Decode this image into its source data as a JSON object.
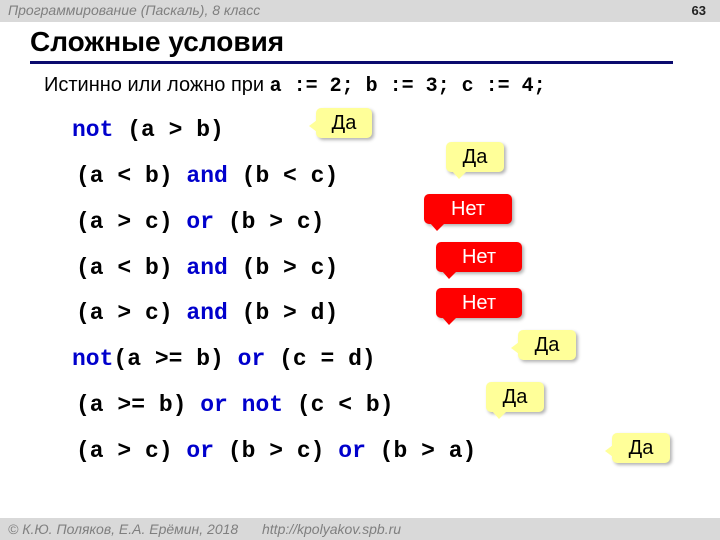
{
  "header": {
    "course": "Программирование (Паскаль), 8 класс",
    "page_number": "63"
  },
  "title": "Сложные условия",
  "intro": {
    "text": "Истинно или ложно при ",
    "assignments": "a := 2; b := 3; c := 4;"
  },
  "expressions": [
    {
      "parts": [
        {
          "t": "not",
          "kw": true
        },
        {
          "t": " (a > b)",
          "kw": false
        }
      ],
      "answer": "Да",
      "truth": true
    },
    {
      "parts": [
        {
          "t": "(a < b) ",
          "kw": false
        },
        {
          "t": "and",
          "kw": true
        },
        {
          "t": " (b < c)",
          "kw": false
        }
      ],
      "answer": "Да",
      "truth": true
    },
    {
      "parts": [
        {
          "t": "(a > c) ",
          "kw": false
        },
        {
          "t": "or",
          "kw": true
        },
        {
          "t": " (b > c)",
          "kw": false
        }
      ],
      "answer": "Нет",
      "truth": false
    },
    {
      "parts": [
        {
          "t": "(a < b) ",
          "kw": false
        },
        {
          "t": "and",
          "kw": true
        },
        {
          "t": " (b > c)",
          "kw": false
        }
      ],
      "answer": "Нет",
      "truth": false
    },
    {
      "parts": [
        {
          "t": "(a > c) ",
          "kw": false
        },
        {
          "t": "and",
          "kw": true
        },
        {
          "t": " (b > d)",
          "kw": false
        }
      ],
      "answer": "Нет",
      "truth": false
    },
    {
      "parts": [
        {
          "t": "not",
          "kw": true
        },
        {
          "t": "(a >= b) ",
          "kw": false
        },
        {
          "t": "or",
          "kw": true
        },
        {
          "t": " (c = d)",
          "kw": false
        }
      ],
      "answer": "Да",
      "truth": true
    },
    {
      "parts": [
        {
          "t": "(a >= b) ",
          "kw": false
        },
        {
          "t": "or",
          "kw": true
        },
        {
          "t": " ",
          "kw": false
        },
        {
          "t": "not",
          "kw": true
        },
        {
          "t": " (c < b)",
          "kw": false
        }
      ],
      "answer": "Да",
      "truth": true
    },
    {
      "parts": [
        {
          "t": "(a > c) ",
          "kw": false
        },
        {
          "t": "or",
          "kw": true
        },
        {
          "t": " (b > c) ",
          "kw": false
        },
        {
          "t": "or",
          "kw": true
        },
        {
          "t": " (b > a)",
          "kw": false
        }
      ],
      "answer": "Да",
      "truth": true
    }
  ],
  "colors": {
    "keyword": "#0000cc",
    "yes_bg": "#ffff99",
    "no_bg": "#ff0000",
    "title_rule": "#0a0a6e"
  },
  "footer": {
    "copyright": "© К.Ю. Поляков, Е.А. Ерёмин, 2018",
    "url": "http://kpolyakov.spb.ru"
  }
}
